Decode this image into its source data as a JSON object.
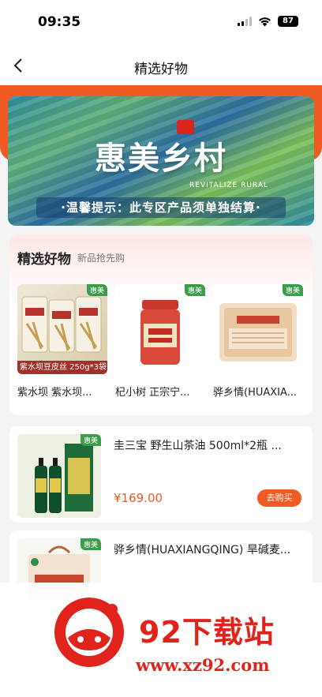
{
  "status_bar": {
    "time": "09:35",
    "battery": "87"
  },
  "nav": {
    "title": "精选好物",
    "back_icon": "chevron-left-icon"
  },
  "banner": {
    "title": "惠美乡村",
    "subtitle": "REVITALIZE RURAL",
    "notice": "·温馨提示：此专区产品须单独结算·"
  },
  "featured": {
    "title": "精选好物",
    "subtitle": "新品抢先购",
    "items": [
      {
        "badge": "惠美",
        "caption": "紫水坝豆皮丝 250g*3袋",
        "name": "紫水坝 紫水坝..."
      },
      {
        "badge": "惠美",
        "caption": "",
        "name": "杞小树 正宗宁..."
      },
      {
        "badge": "惠美",
        "caption": "",
        "name": "骅乡情(HUAXIA..."
      }
    ]
  },
  "list": [
    {
      "badge": "惠美",
      "name": "圭三宝 野生山茶油 500ml*2瓶 ...",
      "price": "¥169.00",
      "buy_label": "去购买"
    },
    {
      "badge": "惠美",
      "name": "骅乡情(HUAXIANGQING) 旱碱麦..."
    }
  ],
  "watermark": {
    "title": "92下载站",
    "url": "www.xz92.com"
  },
  "colors": {
    "accent": "#f05a23",
    "badge": "#3a9d4a",
    "watermark": "#e0241b"
  }
}
